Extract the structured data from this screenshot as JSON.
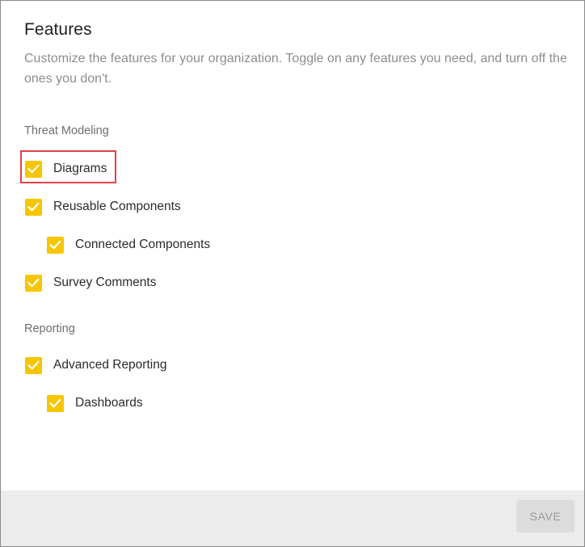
{
  "header": {
    "title": "Features",
    "description": "Customize the features for your organization. Toggle on any features you need, and turn off the ones you don't."
  },
  "sections": [
    {
      "label": "Threat Modeling",
      "items": [
        {
          "label": "Diagrams",
          "checked": true,
          "highlighted": true
        },
        {
          "label": "Reusable Components",
          "checked": true
        },
        {
          "label": "Connected Components",
          "checked": true,
          "nested": true
        },
        {
          "label": "Survey Comments",
          "checked": true
        }
      ]
    },
    {
      "label": "Reporting",
      "items": [
        {
          "label": "Advanced Reporting",
          "checked": true
        },
        {
          "label": "Dashboards",
          "checked": true,
          "nested": true
        }
      ]
    }
  ],
  "footer": {
    "save_label": "SAVE",
    "save_enabled": false
  },
  "colors": {
    "checkbox": "#f7c600",
    "highlight": "#e2424a",
    "footer_bg": "#ececec"
  },
  "icons": {
    "checkbox": "check-icon"
  }
}
